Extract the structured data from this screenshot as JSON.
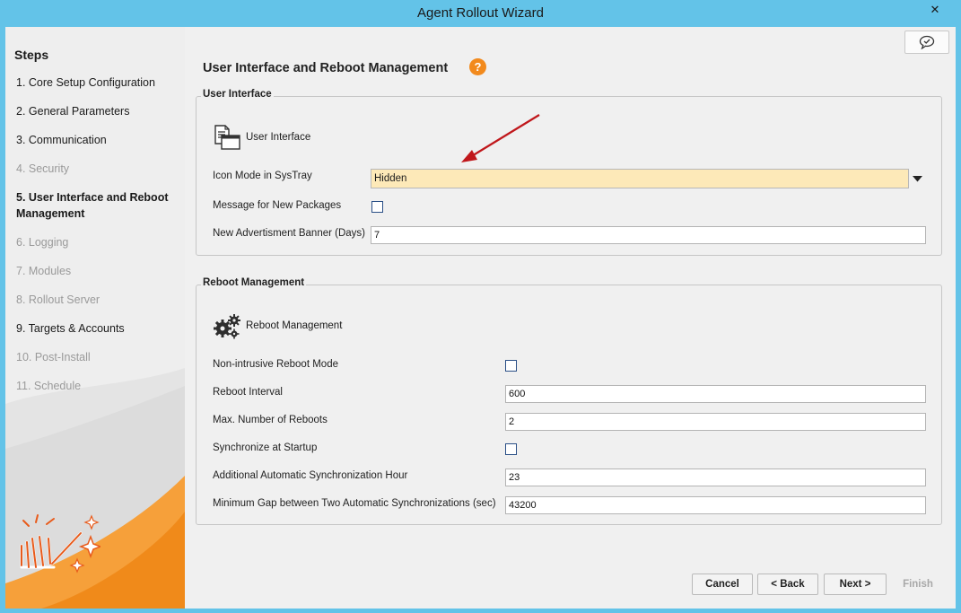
{
  "window": {
    "title": "Agent Rollout Wizard",
    "close_label": "✕"
  },
  "sidebar": {
    "title": "Steps",
    "steps": [
      {
        "label": "1. Core Setup Configuration",
        "state": "enabled"
      },
      {
        "label": "2. General Parameters",
        "state": "enabled"
      },
      {
        "label": "3. Communication",
        "state": "enabled"
      },
      {
        "label": "4. Security",
        "state": "disabled"
      },
      {
        "label": "5. User Interface and Reboot Management",
        "state": "active"
      },
      {
        "label": "6. Logging",
        "state": "disabled"
      },
      {
        "label": "7. Modules",
        "state": "disabled"
      },
      {
        "label": "8. Rollout Server",
        "state": "disabled"
      },
      {
        "label": "9. Targets & Accounts",
        "state": "enabled"
      },
      {
        "label": "10. Post-Install",
        "state": "disabled"
      },
      {
        "label": "11. Schedule",
        "state": "disabled"
      }
    ]
  },
  "main": {
    "page_title": "User Interface and Reboot Management",
    "help_label": "?",
    "user_interface": {
      "legend": "User Interface",
      "heading": "User Interface",
      "icon_mode_label": "Icon Mode in SysTray",
      "icon_mode_value": "Hidden",
      "message_packages_label": "Message for New Packages",
      "message_packages_checked": false,
      "banner_label": "New Advertisment Banner (Days)",
      "banner_value": "7"
    },
    "reboot": {
      "legend": "Reboot Management",
      "heading": "Reboot Management",
      "non_intrusive_label": "Non-intrusive Reboot Mode",
      "non_intrusive_checked": false,
      "interval_label": "Reboot Interval",
      "interval_value": "600",
      "max_reboots_label": "Max. Number of Reboots",
      "max_reboots_value": "2",
      "sync_startup_label": "Synchronize at Startup",
      "sync_startup_checked": false,
      "sync_hour_label": "Additional Automatic Synchronization Hour",
      "sync_hour_value": "23",
      "min_gap_label": "Minimum Gap between Two Automatic Synchronizations (sec)",
      "min_gap_value": "43200"
    }
  },
  "buttons": {
    "cancel": "Cancel",
    "back": "< Back",
    "next": "Next >",
    "finish": "Finish"
  },
  "colors": {
    "titlebar": "#63c3e8",
    "accent_orange": "#f28a1d",
    "combo_highlight": "#fde9b8",
    "arrow_red": "#c0171b"
  },
  "icons": {
    "user_interface": "document-window-icon",
    "reboot": "gears-icon",
    "feedback": "chat-check-icon",
    "brand": "wizard-wand-logo"
  }
}
